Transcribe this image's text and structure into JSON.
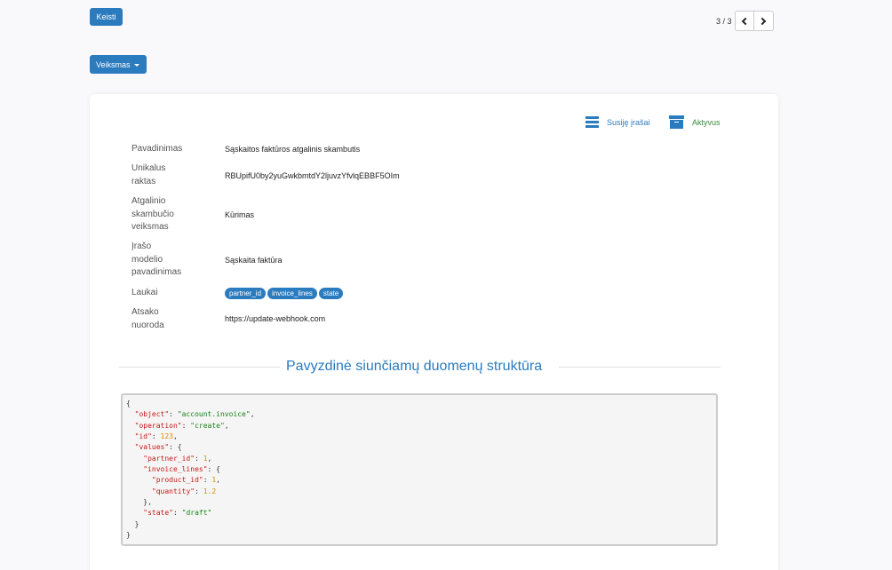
{
  "toolbar": {
    "edit_label": "Keisti",
    "action_label": "Veiksmas"
  },
  "pager": {
    "text": "3 / 3"
  },
  "stats": {
    "related": "Susiję įrašai",
    "active": "Aktyvus"
  },
  "fields": {
    "name": {
      "label": "Pavadinimas",
      "value": "Sąskaitos faktūros atgalinis skambutis"
    },
    "key": {
      "label": "Unikalus raktas",
      "value": "RBUpifU0by2yuGwkbmtdY2ljuvzYfvlqEBBF5OIm"
    },
    "action": {
      "label": "Atgalinio skambučio veiksmas",
      "value": "Kūrimas"
    },
    "model": {
      "label": "Įrašo modelio pavadinimas",
      "value": "Sąskaita faktūra"
    },
    "fields": {
      "label": "Laukai",
      "tags": [
        "partner_id",
        "invoice_lines",
        "state"
      ]
    },
    "url": {
      "label": "Atsako nuoroda",
      "value": "https://update-webhook.com"
    }
  },
  "section": {
    "title": "Pavyzdinė siunčiamų duomenų struktūra"
  },
  "code": {
    "object": "\"account.invoice\"",
    "operation": "\"create\"",
    "id": "123",
    "partner_id": "1",
    "product_id": "1",
    "quantity": "1.2",
    "state": "\"draft\""
  },
  "colors": {
    "primary": "#2b7bbf",
    "success": "#3a8a3a",
    "code_key": "#c41a16",
    "code_string": "#1a7f1a",
    "code_number": "#e38b00"
  }
}
